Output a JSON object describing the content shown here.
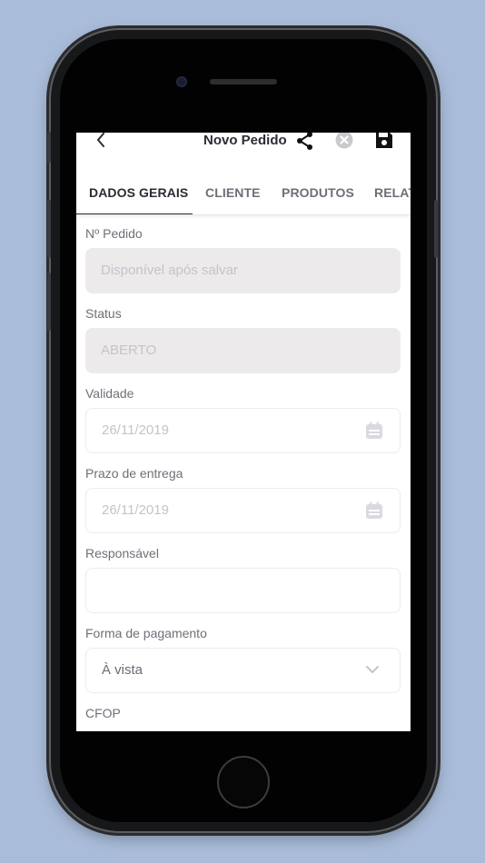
{
  "header": {
    "title": "Novo Pedido",
    "back_icon": "chevron-left-icon",
    "share_icon": "share-icon",
    "close_icon": "close-circle-icon",
    "save_icon": "floppy-disk-icon"
  },
  "tabs": [
    {
      "label": "DADOS GERAIS",
      "active": true
    },
    {
      "label": "CLIENTE",
      "active": false
    },
    {
      "label": "PRODUTOS",
      "active": false
    },
    {
      "label": "RELAT",
      "active": false
    }
  ],
  "form": {
    "numero_pedido": {
      "label": "Nº Pedido",
      "placeholder": "Disponível após salvar"
    },
    "status": {
      "label": "Status",
      "value": "ABERTO"
    },
    "validade": {
      "label": "Validade",
      "value": "26/11/2019"
    },
    "prazo_entrega": {
      "label": "Prazo de entrega",
      "value": "26/11/2019"
    },
    "responsavel": {
      "label": "Responsável",
      "value": ""
    },
    "forma_pagamento": {
      "label": "Forma de pagamento",
      "value": "À vista"
    },
    "cfop": {
      "label": "CFOP"
    }
  },
  "colors": {
    "background": "#a9bcd9",
    "text_primary": "#2a2c33",
    "disabled_field": "#eceaeb",
    "placeholder": "#c3c4cc"
  }
}
